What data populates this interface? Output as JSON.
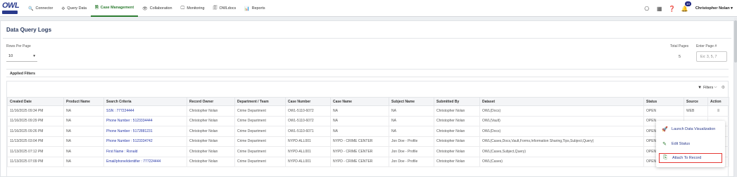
{
  "logo": {
    "text": "OWL"
  },
  "nav": [
    {
      "icon": "search-icon",
      "glyph": "🔍",
      "label": "Connector",
      "active": false
    },
    {
      "icon": "cross-arrows-icon",
      "glyph": "✣",
      "label": "Query Data",
      "active": false
    },
    {
      "icon": "document-icon",
      "glyph": "🗎",
      "label": "Case Management",
      "active": true
    },
    {
      "icon": "eye-icon",
      "glyph": "👁",
      "label": "Collaboration",
      "active": false
    },
    {
      "icon": "monitor-icon",
      "glyph": "🖵",
      "label": "Monitoring",
      "active": false
    },
    {
      "icon": "docs-icon",
      "glyph": "🗐",
      "label": "OWLdocs",
      "active": false
    },
    {
      "icon": "reports-icon",
      "glyph": "📊",
      "label": "Reports",
      "active": false
    }
  ],
  "header_tools": {
    "notification_count": "10",
    "user_name": "Christopher Nolan"
  },
  "page": {
    "title": "Data Query Logs",
    "rows_per_page_label": "Rows Per Page",
    "rows_per_page_value": "10",
    "total_pages_label": "Total Pages",
    "total_pages_value": "5",
    "enter_page_label": "Enter Page #",
    "enter_page_placeholder": "Ex: 3, 5, 7",
    "applied_filters_label": "Applied Filters",
    "filters_label": "Filters"
  },
  "table": {
    "columns": [
      "Created Date",
      "Product Name",
      "Search Criteria",
      "Record Owner",
      "Department / Team",
      "Case Number",
      "Case Name",
      "Subject Name",
      "Submitted By",
      "Dataset",
      "Status",
      "Source",
      "Action"
    ],
    "rows": [
      [
        "11/16/2025 09:34 PM",
        "NA",
        "SSN : 777224444",
        "Christopher Nolan",
        "Crime Department",
        "OWL-5110-6072",
        "NA",
        "NA",
        "Christopher Nolan",
        "OWL(Docs)",
        "OPEN",
        "WEB",
        "≡"
      ],
      [
        "11/16/2025 09:29 PM",
        "NA",
        "Phone Number : 5123334444",
        "Christopher Nolan",
        "Crime Department",
        "OWL-5110-6072",
        "NA",
        "NA",
        "Christopher Nolan",
        "OWL(Vault)",
        "OPEN",
        "",
        ""
      ],
      [
        "11/16/2025 09:26 PM",
        "NA",
        "Phone Number : 5172881231",
        "Christopher Nolan",
        "Crime Department",
        "OWL-5110-6071",
        "NA",
        "NA",
        "Christopher Nolan",
        "OWL(Docs)",
        "OPEN",
        "",
        ""
      ],
      [
        "11/13/2025 03:04 PM",
        "NA",
        "Phone Number : 5123334742",
        "Christopher Nolan",
        "Crime Department",
        "NYPD-ALL001",
        "NYPD - CRIME CENTER",
        "Jon Doe - Profile",
        "Christopher Nolan",
        "OWL(Cases,Docs,Vault,Forms,Information Sharing,Tips,Subject,Query)",
        "OPEN",
        "",
        ""
      ],
      [
        "11/13/2025 07:12 PM",
        "NA",
        "First Name : Ronald",
        "Christopher Nolan",
        "Crime Department",
        "NYPD-ALL001",
        "NYPD - CRIME CENTER",
        "Jon Doe - Profile",
        "Christopher Nolan",
        "OWL(Cases,Subject,Query)",
        "OPEN",
        "",
        ""
      ],
      [
        "11/13/2025 07:09 PM",
        "NA",
        "Email/phone/identifier : 777224444",
        "Christopher Nolan",
        "Crime Department",
        "NYPD-ALL001",
        "NYPD - CRIME CENTER",
        "Jon Doe - Profile",
        "Christopher Nolan",
        "OWL(Cases)",
        "OPEN",
        "",
        ""
      ]
    ]
  },
  "action_menu": [
    {
      "icon": "rocket-icon",
      "glyph": "🚀",
      "label": "Launch Data Visualization",
      "highlighted": false
    },
    {
      "icon": "edit-status-icon",
      "glyph": "✎",
      "label": "Edit Status",
      "highlighted": false
    },
    {
      "icon": "attach-icon",
      "glyph": "⎘",
      "label": "Attach To Record",
      "highlighted": true
    }
  ]
}
